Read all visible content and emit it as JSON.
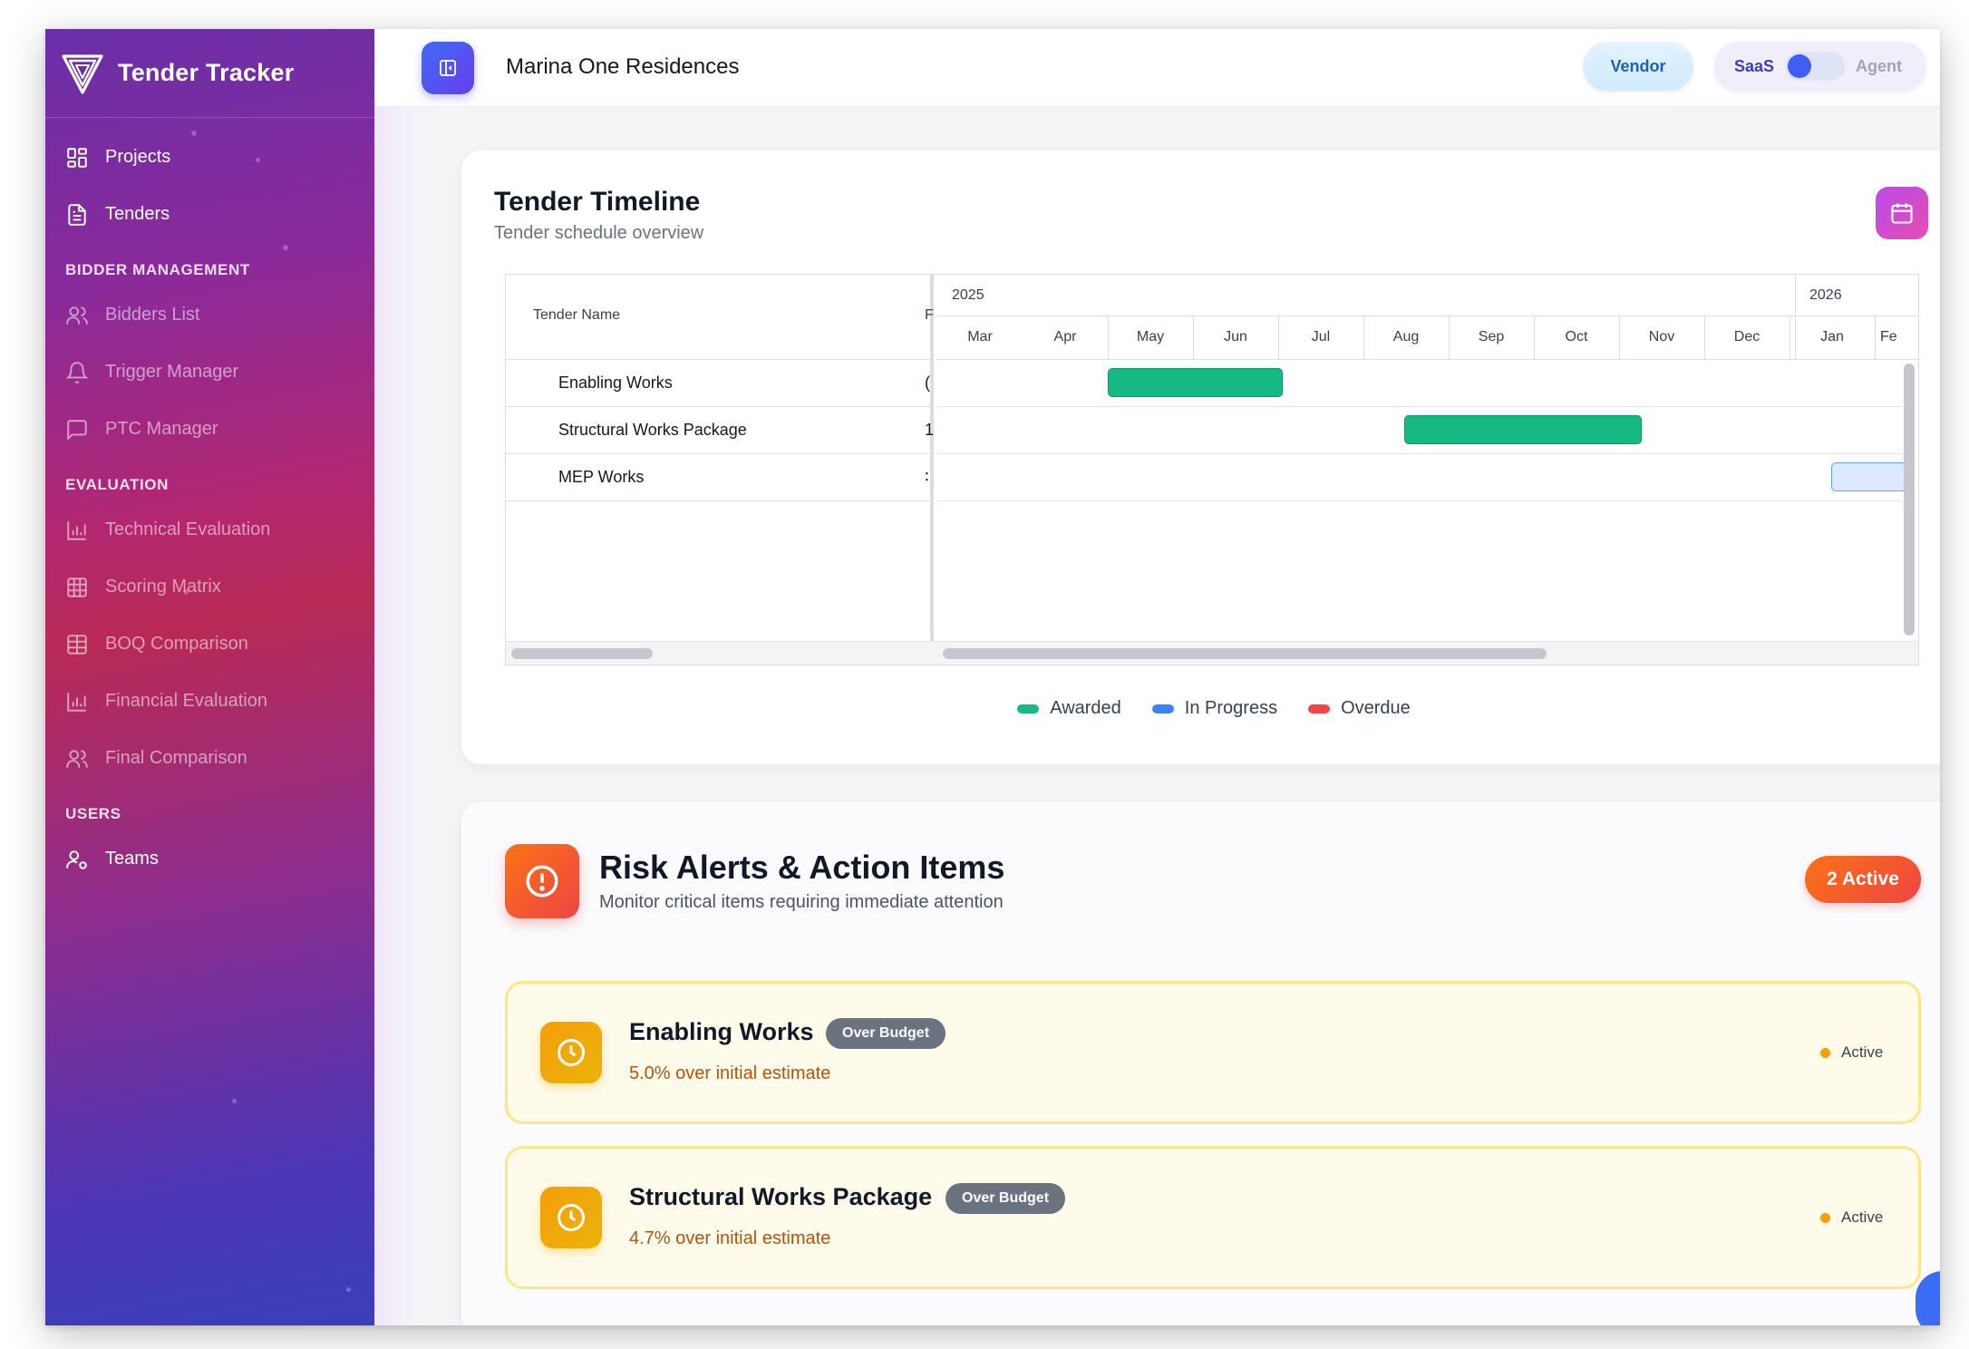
{
  "app": {
    "brand": "Tender Tracker",
    "project_name": "Marina One Residences"
  },
  "header": {
    "vendor_label": "Vendor",
    "mode_left": "SaaS",
    "mode_right": "Agent"
  },
  "sidebar": {
    "items": [
      {
        "label": "Projects",
        "icon": "grid-icon"
      },
      {
        "label": "Tenders",
        "icon": "document-icon"
      }
    ],
    "sections": [
      {
        "title": "BIDDER MANAGEMENT",
        "items": [
          {
            "label": "Bidders List",
            "icon": "users-icon"
          },
          {
            "label": "Trigger Manager",
            "icon": "bell-icon"
          },
          {
            "label": "PTC Manager",
            "icon": "message-icon"
          }
        ]
      },
      {
        "title": "EVALUATION",
        "items": [
          {
            "label": "Technical Evaluation",
            "icon": "bar-chart-icon"
          },
          {
            "label": "Scoring Matrix",
            "icon": "table-icon"
          },
          {
            "label": "BOQ Comparison",
            "icon": "table-icon"
          },
          {
            "label": "Financial Evaluation",
            "icon": "bar-chart-icon"
          },
          {
            "label": "Final Comparison",
            "icon": "users-icon"
          }
        ]
      },
      {
        "title": "USERS",
        "items": [
          {
            "label": "Teams",
            "icon": "user-cog-icon"
          }
        ]
      }
    ]
  },
  "timeline": {
    "title": "Tender Timeline",
    "subtitle": "Tender schedule overview",
    "column_header": "Tender Name",
    "column_header_cut": "F",
    "years": [
      "2025",
      "2026"
    ],
    "months": [
      "Mar",
      "Apr",
      "May",
      "Jun",
      "Jul",
      "Aug",
      "Sep",
      "Oct",
      "Nov",
      "Dec",
      "Jan",
      "Fe"
    ],
    "rows": [
      {
        "name": "Enabling Works",
        "cut": "(",
        "status": "awarded",
        "start": "May",
        "end": "Jun"
      },
      {
        "name": "Structural Works Package",
        "cut": "1",
        "status": "awarded",
        "start": "Aug",
        "end": "Oct"
      },
      {
        "name": "MEP Works",
        "cut": "∶",
        "status": "in-progress",
        "start": "Jan",
        "end": "Fe"
      }
    ],
    "legend": [
      {
        "label": "Awarded",
        "color": "#16b981"
      },
      {
        "label": "In Progress",
        "color": "#3b82f6"
      },
      {
        "label": "Overdue",
        "color": "#ef4444"
      }
    ]
  },
  "risk": {
    "title": "Risk Alerts & Action Items",
    "subtitle": "Monitor critical items requiring immediate attention",
    "active_count": "2 Active",
    "alerts": [
      {
        "title": "Enabling Works",
        "badge": "Over Budget",
        "desc": "5.0% over initial estimate",
        "status": "Active"
      },
      {
        "title": "Structural Works Package",
        "badge": "Over Budget",
        "desc": "4.7% over initial estimate",
        "status": "Active"
      }
    ]
  }
}
